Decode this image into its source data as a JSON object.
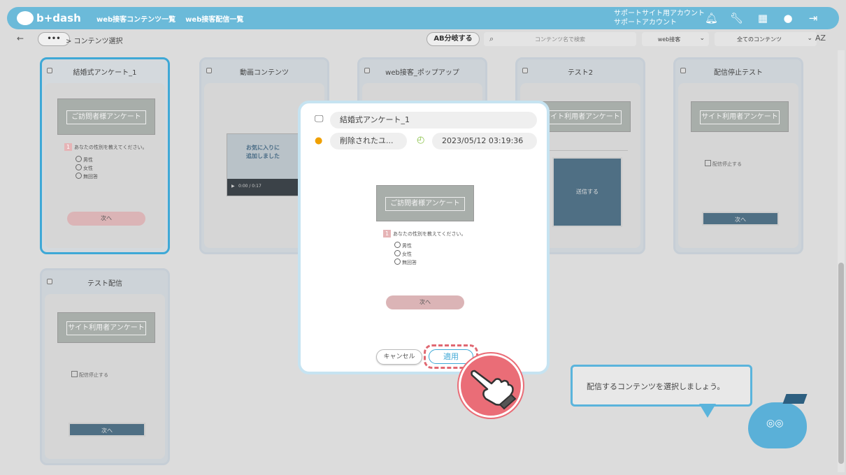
{
  "header": {
    "logo_text": "b+dash",
    "nav": [
      "web接客コンテンツ一覧",
      "web接客配信一覧"
    ],
    "account_line1": "サポートサイト用アカウント",
    "account_line2": "サポートアカウント",
    "icons": [
      "bell-icon",
      "wrench-icon",
      "grid-icon",
      "chat-icon",
      "logout-icon"
    ]
  },
  "toolbar": {
    "back": "←",
    "more": "•••",
    "breadcrumb": "> コンテンツ選択",
    "ab_button": "AB分岐する",
    "search_placeholder": "コンテンツ名で検索",
    "select_type": "web接客",
    "select_filter": "全てのコンテンツ",
    "sort": "AZ"
  },
  "cards": [
    {
      "title": "結婚式アンケート_1",
      "banner": "ご訪問者様アンケート",
      "q_num": "1",
      "question": "あなたの性別を教えてください。",
      "options": [
        "男性",
        "女性",
        "無回答"
      ],
      "button": "次へ"
    },
    {
      "title": "動画コンテンツ",
      "video_text_1": "お気に入りに",
      "video_text_2": "追加しました",
      "video_time": "0:00 / 0:17"
    },
    {
      "title": "web接客_ポップアップ"
    },
    {
      "title": "テスト2",
      "banner": "サイト利用者アンケート",
      "panel_button": "送信する"
    },
    {
      "title": "配信停止テスト",
      "banner": "サイト利用者アンケート",
      "checkbox": "配信停止する",
      "button": "次へ"
    },
    {
      "title": "テスト配信",
      "banner": "サイト利用者アンケート",
      "checkbox": "配信停止する",
      "button": "次へ"
    }
  ],
  "modal": {
    "name": "結婚式アンケート_1",
    "user": "削除されたユ...",
    "datetime": "2023/05/12 03:19:36",
    "preview": {
      "banner": "ご訪問者様アンケート",
      "q_num": "1",
      "question": "あなたの性別を教えてください。",
      "options": [
        "男性",
        "女性",
        "無回答"
      ],
      "button": "次へ"
    },
    "cancel": "キャンセル",
    "apply": "適用"
  },
  "tooltip": "配信するコンテンツを選択しましょう。",
  "colors": {
    "accent": "#6bbad9",
    "highlight": "#3ea8d6",
    "pointer": "#ea6d77"
  }
}
